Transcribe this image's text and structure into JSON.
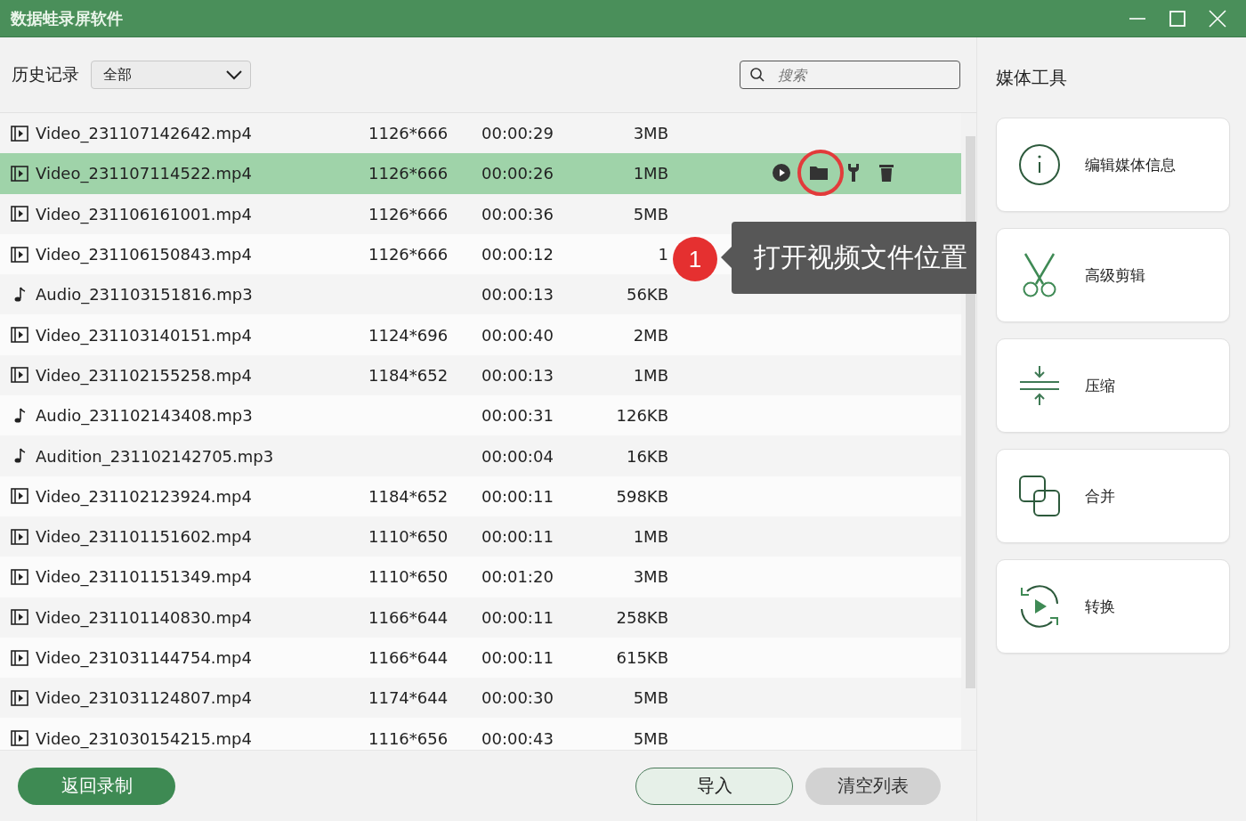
{
  "window": {
    "title": "数据蛙录屏软件"
  },
  "toolbar": {
    "history_label": "历史记录",
    "filter": {
      "value": "全部"
    },
    "search": {
      "placeholder": "搜索"
    }
  },
  "files": [
    {
      "kind": "video",
      "name": "Video_231107142642.mp4",
      "resolution": "1126*666",
      "duration": "00:00:29",
      "size": "3MB",
      "selected": false
    },
    {
      "kind": "video",
      "name": "Video_231107114522.mp4",
      "resolution": "1126*666",
      "duration": "00:00:26",
      "size": "1MB",
      "selected": true
    },
    {
      "kind": "video",
      "name": "Video_231106161001.mp4",
      "resolution": "1126*666",
      "duration": "00:00:36",
      "size": "5MB",
      "selected": false
    },
    {
      "kind": "video",
      "name": "Video_231106150843.mp4",
      "resolution": "1126*666",
      "duration": "00:00:12",
      "size": "1",
      "selected": false
    },
    {
      "kind": "audio",
      "name": "Audio_231103151816.mp3",
      "duration": "00:00:13",
      "size": "56KB",
      "selected": false
    },
    {
      "kind": "video",
      "name": "Video_231103140151.mp4",
      "resolution": "1124*696",
      "duration": "00:00:40",
      "size": "2MB",
      "selected": false
    },
    {
      "kind": "video",
      "name": "Video_231102155258.mp4",
      "resolution": "1184*652",
      "duration": "00:00:13",
      "size": "1MB",
      "selected": false
    },
    {
      "kind": "audio",
      "name": "Audio_231102143408.mp3",
      "duration": "00:00:31",
      "size": "126KB",
      "selected": false
    },
    {
      "kind": "audio",
      "name": "Audition_231102142705.mp3",
      "duration": "00:00:04",
      "size": "16KB",
      "selected": false
    },
    {
      "kind": "video",
      "name": "Video_231102123924.mp4",
      "resolution": "1184*652",
      "duration": "00:00:11",
      "size": "598KB",
      "selected": false
    },
    {
      "kind": "video",
      "name": "Video_231101151602.mp4",
      "resolution": "1110*650",
      "duration": "00:00:11",
      "size": "1MB",
      "selected": false
    },
    {
      "kind": "video",
      "name": "Video_231101151349.mp4",
      "resolution": "1110*650",
      "duration": "00:01:20",
      "size": "3MB",
      "selected": false
    },
    {
      "kind": "video",
      "name": "Video_231101140830.mp4",
      "resolution": "1166*644",
      "duration": "00:00:11",
      "size": "258KB",
      "selected": false
    },
    {
      "kind": "video",
      "name": "Video_231031144754.mp4",
      "resolution": "1166*644",
      "duration": "00:00:11",
      "size": "615KB",
      "selected": false
    },
    {
      "kind": "video",
      "name": "Video_231031124807.mp4",
      "resolution": "1174*644",
      "duration": "00:00:30",
      "size": "5MB",
      "selected": false
    },
    {
      "kind": "video",
      "name": "Video_231030154215.mp4",
      "resolution": "1116*656",
      "duration": "00:00:43",
      "size": "5MB",
      "selected": false
    }
  ],
  "callout": {
    "badge": "1",
    "text": "打开视频文件位置"
  },
  "media_tools": {
    "title": "媒体工具",
    "items": [
      {
        "kind": "info",
        "label": "编辑媒体信息"
      },
      {
        "kind": "cut",
        "label": "高级剪辑"
      },
      {
        "kind": "compress",
        "label": "压缩"
      },
      {
        "kind": "merge",
        "label": "合并"
      },
      {
        "kind": "convert",
        "label": "转换"
      }
    ]
  },
  "buttons": {
    "back": "返回录制",
    "import": "导入",
    "clear": "清空列表"
  }
}
